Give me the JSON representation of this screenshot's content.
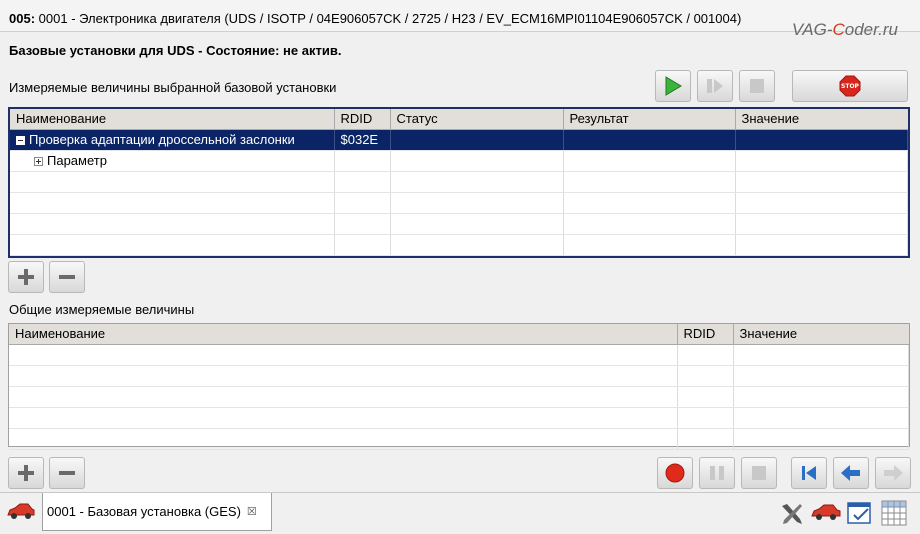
{
  "header": {
    "address": "005:",
    "title_rest": "0001 - Электроника двигателя  (UDS / ISOTP / 04E906057CK / 2725 / H23 / EV_ECM16MPI01104E906057CK / 001004)",
    "watermark_prefix": "VAG-",
    "watermark_c": "C",
    "watermark_suffix": "oder.ru"
  },
  "status": "Базовые установки для UDS - Состояние: не актив.",
  "section1": {
    "label": "Измеряемые величины выбранной базовой установки",
    "columns": [
      "Наименование",
      "RDID",
      "Статус",
      "Результат",
      "Значение"
    ],
    "rows": [
      {
        "name": "Проверка адаптации дроссельной заслонки",
        "rdid": "$032E",
        "status": "",
        "result": "",
        "value": "",
        "selected": true,
        "expander": "minus"
      },
      {
        "name": "Параметр",
        "rdid": "",
        "status": "",
        "result": "",
        "value": "",
        "selected": false,
        "expander": "plus"
      }
    ]
  },
  "section2": {
    "label": "Общие измеряемые величины",
    "columns": [
      "Наименование",
      "RDID",
      "Значение"
    ]
  },
  "tab": {
    "label": "0001 - Базовая установка (GES)",
    "close_glyph": "☒"
  },
  "toolbar": {
    "stop_label": "STOP"
  },
  "colors": {
    "selection": "#0b2466",
    "play_green": "#3cb43c",
    "record_red": "#e02a1a",
    "nav_blue": "#2a6fc4"
  }
}
